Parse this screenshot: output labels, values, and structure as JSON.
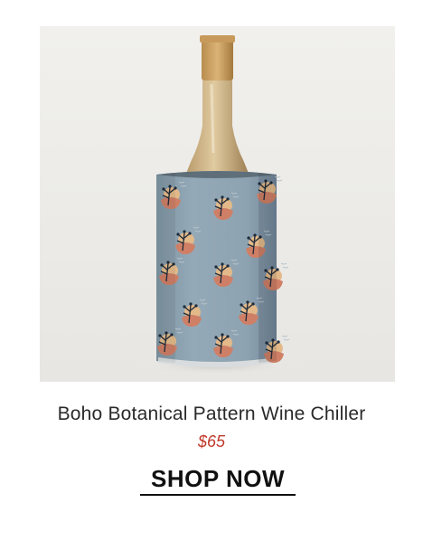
{
  "product": {
    "name": "Boho Botanical Pattern Wine Chiller",
    "price": "$65",
    "price_color": "#c0392b",
    "image_alt": "product-photo"
  },
  "cta": {
    "label": "SHOP NOW"
  },
  "colors": {
    "photo_background": "#eeedea",
    "chiller_blue": "#8fa4b2",
    "accent_terracotta": "#cf7f66",
    "accent_sand": "#e3b98a",
    "text": "#2a2a2a"
  }
}
